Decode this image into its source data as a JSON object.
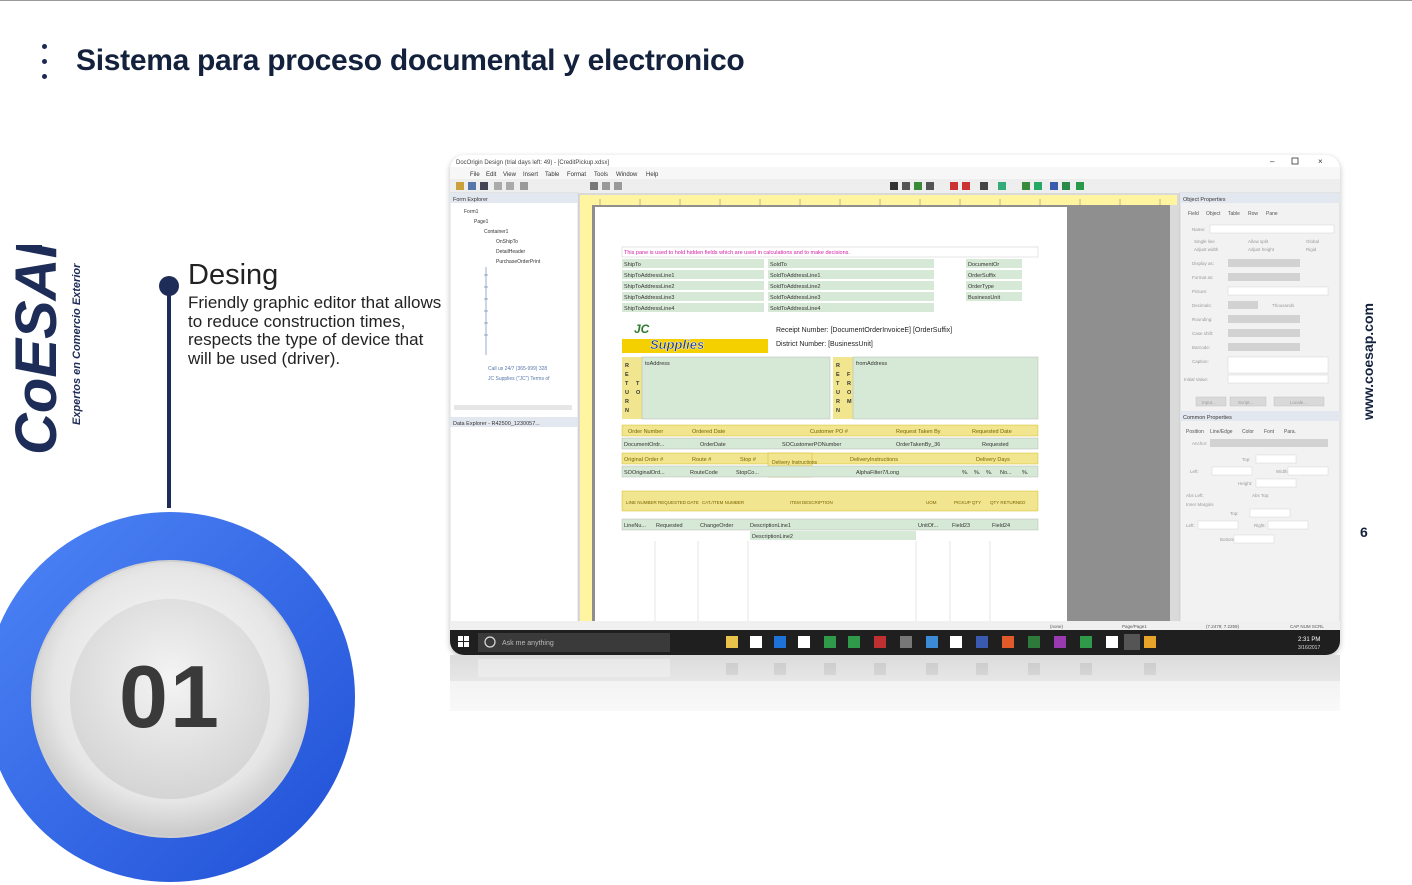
{
  "slide": {
    "title": "Sistema para proceso documental y electronico",
    "brand_name": "CoESAP",
    "brand_tagline": "Expertos en Comercio Exterior",
    "website": "www.coesap.com",
    "page_number": "6",
    "step_number": "01",
    "item_title": "Desing",
    "item_description": "Friendly graphic editor that allows to reduce construction times, respects the type of device that will be used (driver).",
    "colors": {
      "navy": "#13213d",
      "blue": "#2b5fe0",
      "light_blue": "#4f86f7"
    }
  },
  "app": {
    "window_title": "DocOrigin Design (trial days left: 49) - [CreditPickup.xdsx]",
    "menu": [
      "File",
      "Edit",
      "View",
      "Insert",
      "Table",
      "Format",
      "Tools",
      "Window",
      "Help"
    ],
    "form_explorer": {
      "title": "Form Explorer",
      "tree": [
        "Form1",
        "Page1",
        "Container1",
        "OnShipTo",
        "DetailHeader",
        "PurchaseOrderPrint"
      ],
      "footer_items": [
        "Call us 24/7 (365-999) 328",
        "JC Supplies (\"JC\") Terms of"
      ]
    },
    "data_explorer": {
      "title": "Data Explorer - R42500_1230057..."
    },
    "object_properties": {
      "title": "Object Properties",
      "tabs": [
        "Field",
        "Object",
        "Table",
        "Row",
        "Pane"
      ],
      "labels": [
        "Name:",
        "Single line",
        "Adjust width",
        "Allow split",
        "Adjust height",
        "Global",
        "Rigid",
        "Display as:",
        "Format as:",
        "Picture:",
        "Decimals:",
        "Thousands",
        "Rounding:",
        "Case shift:",
        "Barcode:",
        "Caption:",
        "Initial Value:"
      ],
      "buttons": [
        "Input...",
        "Script...",
        "Locale..."
      ]
    },
    "common_properties": {
      "title": "Common Properties",
      "tabs": [
        "Position",
        "Line/Edge",
        "Color",
        "Font",
        "Para."
      ],
      "labels": [
        "Anchor:",
        "Top:",
        "Left:",
        "Width:",
        "Height:",
        "Abs Left:",
        "Abs Top:",
        "Inner Margins",
        "Top:",
        "Left:",
        "Right:",
        "Bottom:"
      ]
    },
    "form": {
      "hidden_note": "This pane is used to hold hidden fields which are used in calculations and to make decisions.",
      "shipto_fields": [
        "ShipTo",
        "ShipToAddressLine1",
        "ShipToAddressLine2",
        "ShipToAddressLine3",
        "ShipToAddressLine4"
      ],
      "soldto_fields": [
        "SoldTo",
        "SoldToAddressLine1",
        "SoldToAddressLine2",
        "SoldToAddressLine3",
        "SoldToAddressLine4"
      ],
      "doc_fields": [
        "DocumentOr",
        "OrderSuffix",
        "OrderType",
        "BusinessUnit"
      ],
      "logo_top": "JC",
      "logo_bottom": "Supplies",
      "receipt_number": "Receipt Number: [DocumentOrderInvoiceE] [OrderSuffix]",
      "district_number": "District Number: [BusinessUnit]",
      "return_label": [
        "R",
        "E",
        "T",
        "U",
        "R",
        "N"
      ],
      "to_label": [
        "T",
        "O"
      ],
      "from_label": [
        "F",
        "R",
        "O",
        "M"
      ],
      "to_address": "toAddress",
      "from_address": "fromAddress",
      "header1": [
        "Order Number",
        "Ordered Date",
        "Customer PO #",
        "Request Taken By",
        "Requested Date"
      ],
      "row1": [
        "DocumentOrdr...",
        "OrderDate",
        "SOCustomerPONumber",
        "OrderTakenBy_36",
        "Requested"
      ],
      "header2": [
        "Original Order #",
        "Route #",
        "Stop #",
        "Delivery Instructions",
        "DeliveryInstructions",
        "Delivery Days"
      ],
      "row2": [
        "SOOriginalOrd...",
        "RouteCode",
        "StopCo...",
        "AlphaFilter7/Long",
        "%.",
        "%.",
        "%.",
        "No...",
        "%."
      ],
      "items_header": [
        "LINE NUMBER",
        "REQUESTED DATE",
        "CAT./ITEM NUMBER",
        "ITEM DESCRIPTION",
        "UOM",
        "PICKUP QTY",
        "QTY RETURNED"
      ],
      "items_row": [
        "LineNu...",
        "Requested",
        "ChangeOrder",
        "DescriptionLine1",
        "UnitOf...",
        "Field23",
        "Field24"
      ],
      "items_row2": "DescriptionLine2"
    },
    "status_bar": [
      "(none)",
      "Page/Page1",
      "(7.2479; 7.2259)",
      "CAP NUM SCRL"
    ],
    "taskbar": {
      "search_placeholder": "Ask me anything",
      "time": "2:31 PM",
      "date": "3/16/2017"
    }
  }
}
